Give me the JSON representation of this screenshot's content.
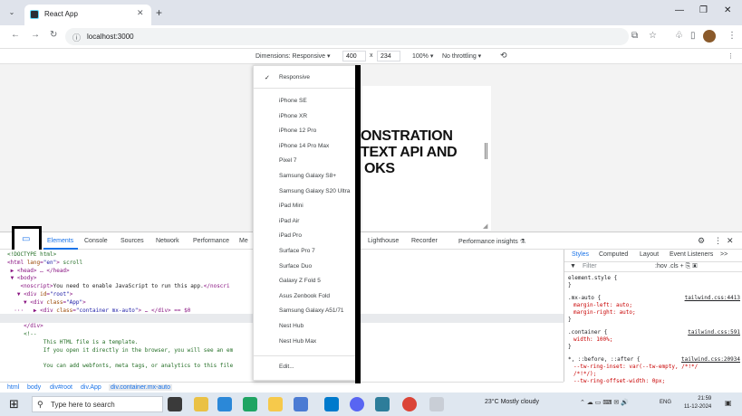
{
  "browser": {
    "tab_title": "React App",
    "url": "localhost:3000",
    "new_tab": "+",
    "minimize": "—",
    "restore": "❐",
    "close": "✕"
  },
  "device_toolbar": {
    "dimensions_label": "Dimensions: Responsive ▾",
    "width": "400",
    "times": "x",
    "height": "234",
    "zoom": "100% ▾",
    "throttling": "No throttling ▾"
  },
  "page": {
    "hero_lines": [
      "ONSTRATION",
      "TEXT API AND",
      "OKS"
    ]
  },
  "device_menu": {
    "selected": "Responsive",
    "items": [
      "iPhone SE",
      "iPhone XR",
      "iPhone 12 Pro",
      "iPhone 14 Pro Max",
      "Pixel 7",
      "Samsung Galaxy S8+",
      "Samsung Galaxy S20 Ultra",
      "iPad Mini",
      "iPad Air",
      "iPad Pro",
      "Surface Pro 7",
      "Surface Duo",
      "Galaxy Z Fold 5",
      "Asus Zenbook Fold",
      "Samsung Galaxy A51/71",
      "Nest Hub",
      "Nest Hub Max"
    ],
    "edit": "Edit..."
  },
  "devtools": {
    "tabs": [
      "Elements",
      "Console",
      "Sources",
      "Network",
      "Performance",
      "Me",
      "Lighthouse",
      "Recorder",
      "Performance insights ⚗"
    ],
    "more": ">>",
    "styles_tabs": [
      "Styles",
      "Computed",
      "Layout",
      "Event Listeners",
      ">>"
    ],
    "filter_placeholder": "Filter",
    "filter_tools": ":hov .cls + ⎘ ▣",
    "breadcrumbs": [
      "html",
      "body",
      "div#root",
      "div.App",
      "div.container.mx-auto"
    ]
  },
  "code_lines": [
    {
      "html": "<span class='cmt'>&lt;!DOCTYPE html&gt;</span>"
    },
    {
      "html": "<span class='tag'>&lt;html</span> <span class='attr'>lang</span>=<span class='val'>\"en\"</span><span class='tag'>&gt;</span> <span class='cmt'>scroll</span>"
    },
    {
      "html": " ▶ <span class='tag'>&lt;head&gt;</span> … <span class='tag'>&lt;/head&gt;</span>"
    },
    {
      "html": " ▼ <span class='tag'>&lt;body&gt;</span>"
    },
    {
      "html": "    <span class='tag'>&lt;noscript&gt;</span><span class='txt'>You need to enable JavaScript to run this app.</span><span class='tag'>&lt;/noscri</span>"
    },
    {
      "html": "   ▼ <span class='tag'>&lt;div</span> <span class='attr'>id</span>=<span class='val'>\"root\"</span><span class='tag'>&gt;</span>"
    },
    {
      "html": "     ▼ <span class='tag'>&lt;div</span> <span class='attr'>class</span>=<span class='val'>\"App\"</span><span class='tag'>&gt;</span>"
    },
    {
      "html": "  ···   ▶ <span class='tag'>&lt;div</span> <span class='attr'>class</span>=<span class='val'>\"container mx-auto\"</span><span class='tag'>&gt;</span> … <span class='tag'>&lt;/div&gt;</span> == $0"
    },
    {
      "html": "       <span class='tag'>&lt;/div&gt;</span>"
    },
    {
      "html": "     <span class='tag'>&lt;/div&gt;</span>"
    },
    {
      "html": "     <span class='cmt'>&lt;!--</span>"
    },
    {
      "html": "<span class='cmt'>           This HTML file is a template.</span>"
    },
    {
      "html": "<span class='cmt'>           If you open it directly in the browser, you will see an em</span>"
    },
    {
      "html": ""
    },
    {
      "html": "<span class='cmt'>           You can add webfonts, meta tags, or analytics to this file</span>"
    }
  ],
  "styles_rules": [
    {
      "selector": "element.style {",
      "file": "",
      "props": [
        "}"
      ]
    },
    {
      "selector": ".mx-auto {",
      "file": "tailwind.css:4413",
      "props": [
        "margin-left: auto;",
        "margin-right: auto;",
        "}"
      ]
    },
    {
      "selector": ".container {",
      "file": "tailwind.css:591",
      "props": [
        "width: 100%;",
        "}"
      ]
    },
    {
      "selector": "*, ::before, ::after {",
      "file": "tailwind.css:20934",
      "props": [
        "--tw-ring-inset: var(--tw-empty, /*!*/",
        "/*!*/);",
        "--tw-ring-offset-width: 0px;"
      ]
    }
  ],
  "taskbar": {
    "search_placeholder": "Type here to search",
    "weather": "23°C  Mostly cloudy",
    "lang": "ENG",
    "time": "21:59",
    "date": "11-12-2024"
  }
}
